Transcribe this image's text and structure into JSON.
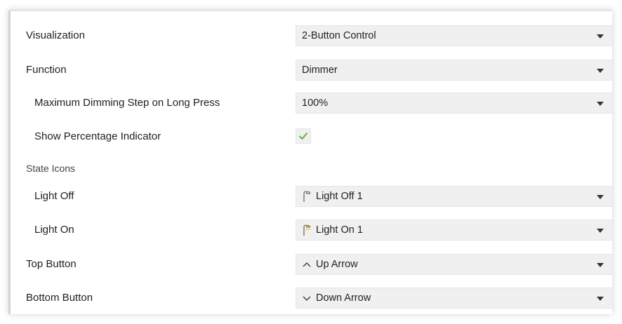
{
  "rows": [
    {
      "label": "Visualization",
      "value": "2-Button Control"
    },
    {
      "label": "Function",
      "value": "Dimmer"
    },
    {
      "label": "Maximum Dimming Step on Long Press",
      "value": "100%"
    },
    {
      "label": "Show Percentage Indicator",
      "checked": true
    },
    {
      "label": "State Icons"
    },
    {
      "label": "Light Off",
      "value": "Light Off 1",
      "icon": "lamp-off-icon"
    },
    {
      "label": "Light On",
      "value": "Light On 1",
      "icon": "lamp-on-icon"
    },
    {
      "label": "Top Button",
      "value": "Up Arrow",
      "icon": "up-arrow-icon"
    },
    {
      "label": "Bottom Button",
      "value": "Down Arrow",
      "icon": "down-arrow-icon"
    }
  ],
  "colors": {
    "check": "#6ab04c",
    "lamp_on": "#e6b800",
    "field_bg": "#f0f0f0"
  }
}
